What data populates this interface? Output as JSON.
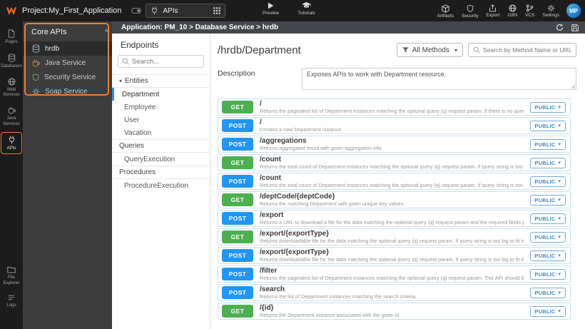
{
  "colors": {
    "accent_orange": "#ED7D31",
    "get_green": "#4CAF50",
    "post_blue": "#2196F3",
    "public_blue": "#3A87C8",
    "topbar_bg": "#1C1C1C",
    "panel_dark_bg": "#3D3D3D"
  },
  "topbar": {
    "project_label": "Project:My_First_Application",
    "workspace": {
      "selected": "APIs"
    },
    "center_actions": [
      {
        "label": "Preview",
        "icon": "play-icon"
      },
      {
        "label": "Tutorials",
        "icon": "tutorials-icon"
      }
    ],
    "right_actions": [
      {
        "label": "Artifacts",
        "icon": "artifacts-icon"
      },
      {
        "label": "Security",
        "icon": "security-icon"
      },
      {
        "label": "Export",
        "icon": "export-icon"
      },
      {
        "label": "I18N",
        "icon": "i18n-icon"
      },
      {
        "label": "VCS",
        "icon": "vcs-icon"
      },
      {
        "label": "Settings",
        "icon": "gear-icon"
      }
    ],
    "avatar_initials": "MP"
  },
  "left_sidebar": {
    "top_items": [
      {
        "label": "Pages",
        "icon": "pages-icon"
      },
      {
        "label": "Databases",
        "icon": "database-icon"
      },
      {
        "label": "Web Services",
        "icon": "globe-icon"
      },
      {
        "label": "Java Services",
        "icon": "coffee-icon"
      },
      {
        "label": "APIs",
        "icon": "api-icon",
        "active": true
      }
    ],
    "bottom_items": [
      {
        "label": "File Explorer",
        "icon": "folder-icon"
      },
      {
        "label": "Logs",
        "icon": "logs-icon"
      }
    ]
  },
  "core_apis_panel": {
    "title": "Core APIs",
    "collapse_glyph": "«",
    "items": [
      {
        "label": "hrdb",
        "icon": "database-icon",
        "selected": true
      },
      {
        "label": "Java Service",
        "icon": "coffee-icon"
      },
      {
        "label": "Security Service",
        "icon": "shield-icon"
      },
      {
        "label": "Soap Service",
        "icon": "gear-icon"
      }
    ]
  },
  "breadcrumb": "Application: PM_10 > Database Service > hrdb",
  "endpoints_panel": {
    "title": "Endpoints",
    "search_placeholder": "Search...",
    "sections": [
      {
        "label": "Entities",
        "caret": true,
        "items": [
          {
            "label": "Department",
            "selected": true
          },
          {
            "label": "Employee"
          },
          {
            "label": "User"
          },
          {
            "label": "Vacation"
          }
        ]
      },
      {
        "label": "Queries",
        "caret": false,
        "items": [
          {
            "label": "QueryExecution"
          }
        ]
      },
      {
        "label": "Procedures",
        "caret": false,
        "items": [
          {
            "label": "ProcedureExecution"
          }
        ]
      }
    ]
  },
  "main": {
    "title": "/hrdb/Department",
    "methods_filter_label": "All Methods",
    "search_placeholder": "Search by Method Name or URL...",
    "description_label": "Description",
    "description_value": "Exposes APIs to work with Department resource.",
    "endpoints": [
      {
        "method": "GET",
        "path": "/",
        "desc": "Returns the paginated list of Department instances matching the optional query (q) request param. If there is no query pro...",
        "access": "PUBLIC"
      },
      {
        "method": "POST",
        "path": "/",
        "desc": "Creates a new Department instance.",
        "access": "PUBLIC"
      },
      {
        "method": "POST",
        "path": "/aggregations",
        "desc": "Returns aggregated result with given aggregation info",
        "access": "PUBLIC"
      },
      {
        "method": "GET",
        "path": "/count",
        "desc": "Returns the total count of Department instances matching the optional query (q) request param. If query string is too big t...",
        "access": "PUBLIC"
      },
      {
        "method": "POST",
        "path": "/count",
        "desc": "Returns the total count of Department instances matching the optional query (q) request param. If query string is too big t...",
        "access": "PUBLIC"
      },
      {
        "method": "GET",
        "path": "/deptCode/{deptCode}",
        "desc": "Returns the matching Department with given unique key values.",
        "access": "PUBLIC"
      },
      {
        "method": "POST",
        "path": "/export",
        "desc": "Returns a URL to download a file for the data matching the optional query (q) request param and the required fields provid...",
        "access": "PUBLIC"
      },
      {
        "method": "GET",
        "path": "/export/{exportType}",
        "desc": "Returns downloadable file for the data matching the optional query (q) request param. If query string is too big to fit in GET...",
        "access": "PUBLIC"
      },
      {
        "method": "POST",
        "path": "/export/{exportType}",
        "desc": "Returns downloadable file for the data matching the optional query (q) request param. If query string is too big to fit in GET...",
        "access": "PUBLIC"
      },
      {
        "method": "POST",
        "path": "/filter",
        "desc": "Returns the paginated list of Department instances matching the optional query (q) request param. This API should be use...",
        "access": "PUBLIC"
      },
      {
        "method": "POST",
        "path": "/search",
        "desc": "Returns the list of Department instances matching the search criteria.",
        "access": "PUBLIC"
      },
      {
        "method": "GET",
        "path": "/{id}",
        "desc": "Returns the Department instance associated with the given id.",
        "access": "PUBLIC"
      }
    ]
  }
}
